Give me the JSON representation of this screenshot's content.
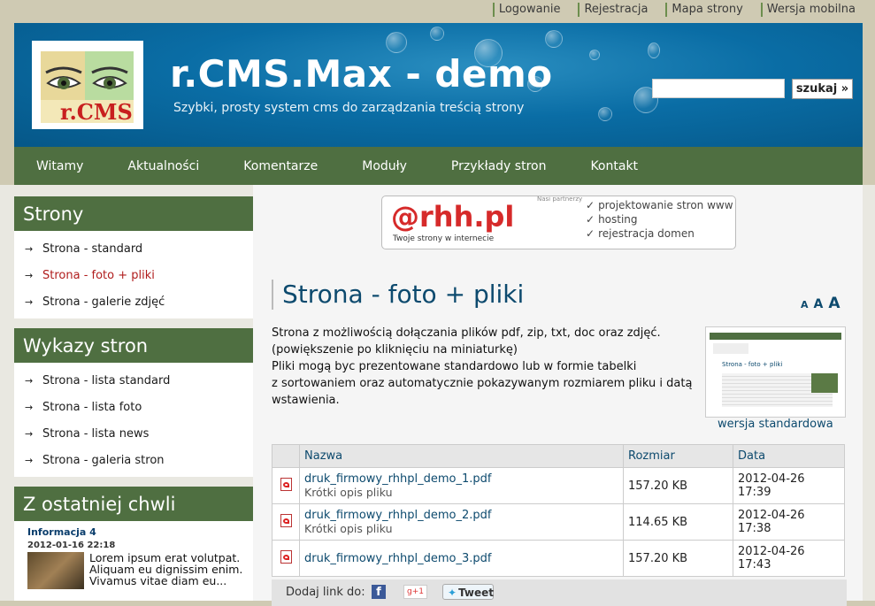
{
  "toplinks": [
    "Logowanie",
    "Rejestracja",
    "Mapa strony",
    "Wersja mobilna"
  ],
  "header": {
    "logo_text": "r.CMS",
    "title": "r.CMS.Max - demo",
    "subtitle": "Szybki, prosty system cms do zarządzania treścią strony",
    "search_placeholder": "",
    "search_button": "szukaj »"
  },
  "nav": [
    "Witamy",
    "Aktualności",
    "Komentarze",
    "Moduły",
    "Przykłady stron",
    "Kontakt"
  ],
  "sidebar": {
    "strony": {
      "title": "Strony",
      "items": [
        {
          "label": "Strona - standard",
          "active": false
        },
        {
          "label": "Strona - foto + pliki",
          "active": true
        },
        {
          "label": "Strona - galerie zdjęć",
          "active": false
        }
      ]
    },
    "wykazy": {
      "title": "Wykazy stron",
      "items": [
        {
          "label": "Strona - lista standard"
        },
        {
          "label": "Strona - lista foto"
        },
        {
          "label": "Strona - lista news"
        },
        {
          "label": "Strona - galeria stron"
        }
      ]
    },
    "news": {
      "title": "Z ostatniej chwli",
      "item_title": "Informacja 4",
      "item_date": "2012-01-16 22:18",
      "item_text": "Lorem ipsum erat volutpat. Aliquam eu dignissim enim. Vivamus vitae diam eu..."
    }
  },
  "banner": {
    "partners": "Nasi partnerzy",
    "brand": "@rhh",
    "brand_suffix": ".pl",
    "tagline": "Twoje strony w internecie",
    "features": [
      "projektowanie stron www",
      "hosting",
      "rejestracja domen"
    ]
  },
  "page": {
    "title": "Strona - foto + pliki",
    "font_sizes": [
      "A",
      "A",
      "A"
    ],
    "desc_lines": [
      "Strona z możliwością dołączania plików pdf, zip, txt, doc oraz zdjęć.",
      "(powiększenie po kliknięciu na miniaturkę)",
      "Pliki mogą byc prezentowane standardowo lub w formie tabelki",
      "z sortowaniem oraz automatycznie pokazywanym rozmiarem pliku i datą",
      "wstawienia."
    ],
    "thumb_title": "Strona - foto + pliki",
    "thumb_caption": "wersja standardowa"
  },
  "files": {
    "headers": [
      "Nazwa",
      "Rozmiar",
      "Data"
    ],
    "rows": [
      {
        "name": "druk_firmowy_rhhpl_demo_1.pdf",
        "desc": "Krótki opis pliku",
        "size": "157.20 KB",
        "date": "2012-04-26 17:39"
      },
      {
        "name": "druk_firmowy_rhhpl_demo_2.pdf",
        "desc": "Krótki opis pliku",
        "size": "114.65 KB",
        "date": "2012-04-26 17:38"
      },
      {
        "name": "druk_firmowy_rhhpl_demo_3.pdf",
        "desc": "",
        "size": "157.20 KB",
        "date": "2012-04-26 17:43"
      }
    ]
  },
  "share": {
    "label": "Dodaj link do:",
    "fb": "f",
    "gplus": "g+1",
    "tweet": "Tweet"
  }
}
